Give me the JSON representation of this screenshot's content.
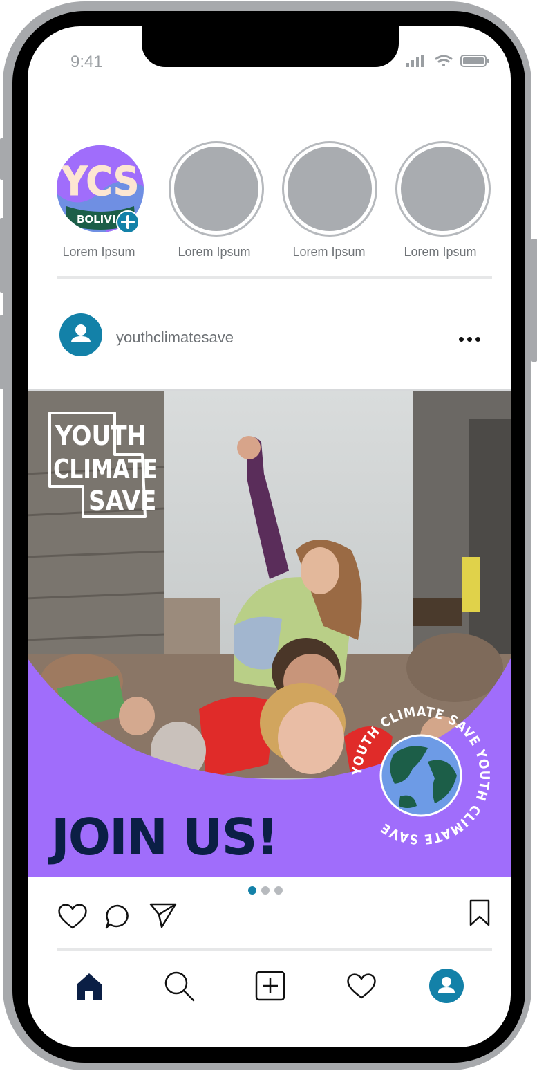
{
  "status_bar": {
    "time": "9:41"
  },
  "stories": [
    {
      "label": "Lorem Ipsum",
      "has_logo": true,
      "logo_text": "YCS",
      "logo_banner": "BOLIVIA"
    },
    {
      "label": "Lorem Ipsum"
    },
    {
      "label": "Lorem Ipsum"
    },
    {
      "label": "Lorem Ipsum"
    }
  ],
  "post": {
    "username": "youthclimatesave",
    "image": {
      "brand_logo": [
        "YOUTH",
        "CLIMATE",
        "SAVE"
      ],
      "headline": "JOIN US!",
      "circular_text": "YOUTH CLIMATE SAVE YOUTH CLIMATE SAVE"
    },
    "carousel": {
      "count": 3,
      "active": 0
    }
  },
  "colors": {
    "accent": "#1381a8",
    "purple": "#a06dfb",
    "navy": "#0b1f45",
    "placeholder": "#a9acb0"
  },
  "icons": {
    "actions": [
      "heart-icon",
      "comment-icon",
      "send-icon",
      "bookmark-icon"
    ],
    "nav": [
      "home-icon",
      "search-icon",
      "add-post-icon",
      "activity-heart-icon",
      "profile-icon"
    ]
  }
}
